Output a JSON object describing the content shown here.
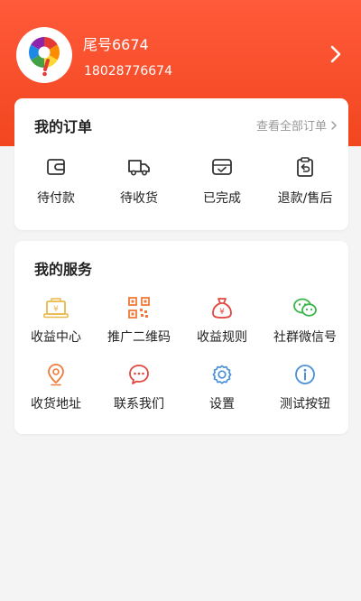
{
  "user": {
    "name": "尾号6674",
    "phone": "18028776674"
  },
  "orders": {
    "title": "我的订单",
    "view_all": "查看全部订单",
    "items": [
      {
        "label": "待付款",
        "icon": "wallet-icon"
      },
      {
        "label": "待收货",
        "icon": "truck-icon"
      },
      {
        "label": "已完成",
        "icon": "inbox-check-icon"
      },
      {
        "label": "退款/售后",
        "icon": "clipboard-return-icon"
      }
    ]
  },
  "services": {
    "title": "我的服务",
    "items": [
      {
        "label": "收益中心",
        "icon": "earnings-center-icon"
      },
      {
        "label": "推广二维码",
        "icon": "qr-code-icon"
      },
      {
        "label": "收益规则",
        "icon": "money-bag-icon"
      },
      {
        "label": "社群微信号",
        "icon": "wechat-icon"
      },
      {
        "label": "收货地址",
        "icon": "location-pin-icon"
      },
      {
        "label": "联系我们",
        "icon": "chat-bubble-icon"
      },
      {
        "label": "设置",
        "icon": "gear-icon"
      },
      {
        "label": "测试按钮",
        "icon": "info-icon"
      }
    ]
  },
  "colors": {
    "header": "#f2461f",
    "icon_yellow": "#e8b84a",
    "icon_orange": "#f07a3a",
    "icon_red": "#e0473f",
    "icon_green": "#3ab54a",
    "icon_blue": "#4a90d9"
  }
}
